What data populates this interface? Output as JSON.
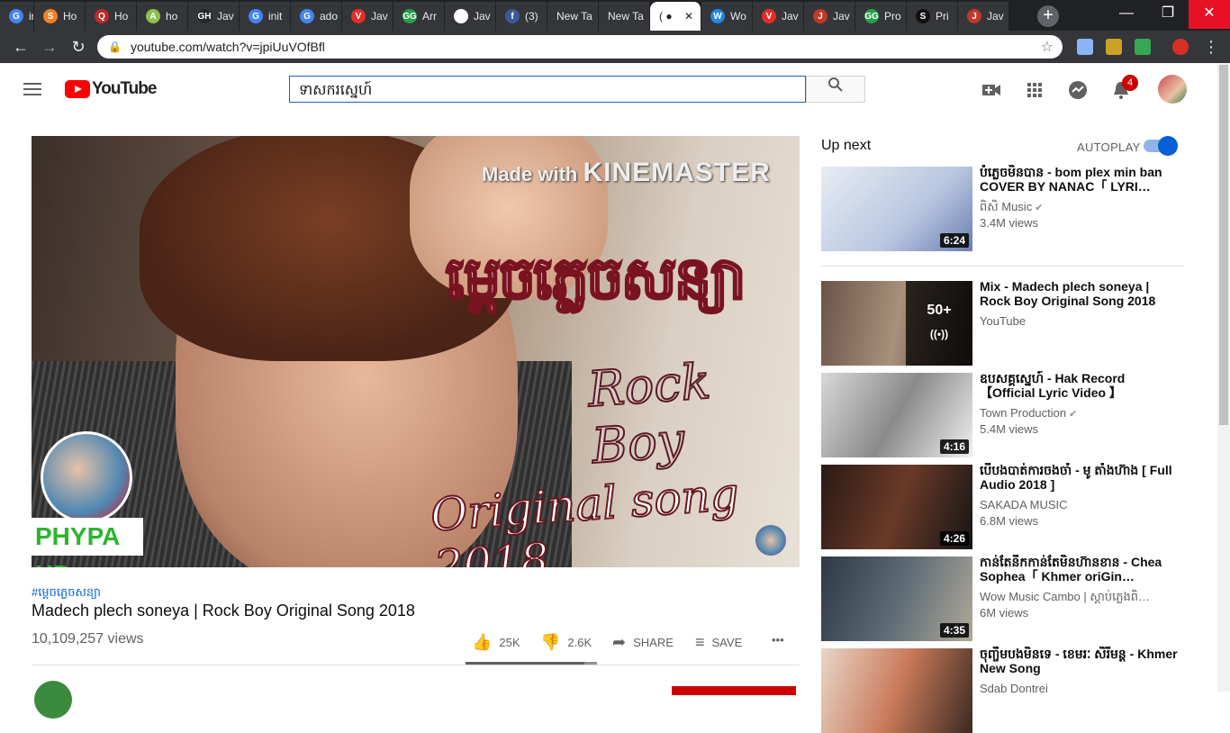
{
  "browser": {
    "tabs": [
      {
        "label": "inp",
        "fav": "G",
        "color": "#4285f4"
      },
      {
        "label": "Ho",
        "fav": "S",
        "color": "#f48024"
      },
      {
        "label": "Ho",
        "fav": "Q",
        "color": "#b92b27"
      },
      {
        "label": "ho",
        "fav": "A",
        "color": "#8bc34a"
      },
      {
        "label": "Jav",
        "fav": "GH",
        "color": "#24292e"
      },
      {
        "label": "init",
        "fav": "G",
        "color": "#4285f4"
      },
      {
        "label": "ado",
        "fav": "G",
        "color": "#4285f4"
      },
      {
        "label": "Jav",
        "fav": "V",
        "color": "#e52d27"
      },
      {
        "label": "Arr",
        "fav": "GG",
        "color": "#24a148"
      },
      {
        "label": "Jav",
        "fav": "SF",
        "color": "#ffffff"
      },
      {
        "label": "(3)",
        "fav": "f",
        "color": "#3b5998"
      },
      {
        "label": "New Ta",
        "fav": "",
        "color": "#35363a"
      },
      {
        "label": "New Ta",
        "fav": "",
        "color": "#35363a"
      },
      {
        "label": "( ●",
        "fav": "",
        "color": "#ffffff"
      },
      {
        "label": "Wo",
        "fav": "W",
        "color": "#1e88e5"
      },
      {
        "label": "Jav",
        "fav": "V",
        "color": "#e52d27"
      },
      {
        "label": "Jav",
        "fav": "J",
        "color": "#c0392b"
      },
      {
        "label": "Pro",
        "fav": "GG",
        "color": "#24a148"
      },
      {
        "label": "Pri",
        "fav": "S",
        "color": "#111111"
      },
      {
        "label": "Jav",
        "fav": "J",
        "color": "#c0392b"
      }
    ],
    "url": "youtube.com/watch?v=jpiUuVOfBfl",
    "new_tab": "+",
    "win_min": "—",
    "win_max": "❐",
    "win_close": "✕"
  },
  "header": {
    "logo_text": "YouTube",
    "search_value": "ទាសករស្នេហ៍",
    "notif_count": "4"
  },
  "video": {
    "overlay_made_with": "Made with",
    "overlay_kinemaster": "KINEMASTER",
    "overlay_khmer_title": "ម្តេចភ្លេចសន្យា",
    "overlay_rock_boy": "Rock Boy",
    "overlay_original": "Original song 2018",
    "overlay_phypa": "PHYPA HD",
    "hashtag": "#ម្តេចភ្លេចសន្យា",
    "title": "Madech plech soneya | Rock Boy Original Song 2018",
    "views": "10,109,257 views",
    "likes": "25K",
    "dislikes": "2.6K",
    "share_label": "SHARE",
    "save_label": "SAVE",
    "more_label": "•••",
    "sentiment_ratio": 0.906
  },
  "rail": {
    "up_next": "Up next",
    "autoplay": "AUTOPLAY",
    "autoplay_on": true,
    "items": [
      {
        "title": "បំភ្លេចមិនបាន - bom plex min ban COVER BY NANAC「 LYRI…",
        "channel": "ពិសិ Music",
        "verified": true,
        "views": "3.4M views",
        "duration": "6:24"
      },
      {
        "title": "Mix - Madech plech soneya | Rock Boy Original Song 2018",
        "channel": "YouTube",
        "verified": false,
        "views": "",
        "duration": "",
        "mix_count": "50+"
      },
      {
        "title": "ឧបសគ្គស្នេហ៍ - Hak Record 【Official Lyric Video 】",
        "channel": "Town Production",
        "verified": true,
        "views": "5.4M views",
        "duration": "4:16"
      },
      {
        "title": "បើបងបាត់ការចងចាំ - មូ តាំងហ៊ាង [ Full Audio 2018 ]",
        "channel": "SAKADA MUSIC",
        "verified": false,
        "views": "6.8M views",
        "duration": "4:26"
      },
      {
        "title": "កាន់តែនឹកកាន់តែមិនហ៊ានខាន - Chea Sophea「 Khmer oriGin…",
        "channel": "Wow Music Cambo | ស្តាប់ភ្លេងពិ…",
        "verified": false,
        "views": "6M views",
        "duration": "4:35"
      },
      {
        "title": "ចុញ្ចឹមបងមិនទេ - ខេមរៈ សិរីមន្ត - Khmer New Song",
        "channel": "Sdab Dontrei",
        "verified": false,
        "views": "",
        "duration": ""
      }
    ]
  }
}
